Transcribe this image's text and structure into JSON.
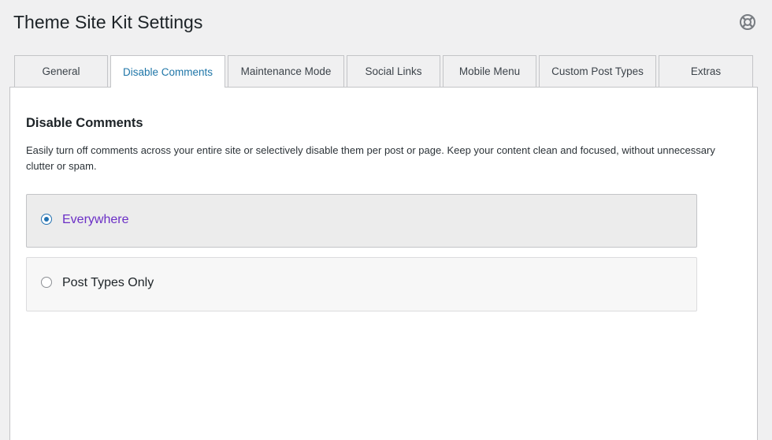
{
  "header": {
    "title": "Theme Site Kit Settings",
    "help_icon": "lifebuoy-icon"
  },
  "tabs": [
    {
      "label": "General",
      "active": false
    },
    {
      "label": "Disable Comments",
      "active": true
    },
    {
      "label": "Maintenance Mode",
      "active": false
    },
    {
      "label": "Social Links",
      "active": false
    },
    {
      "label": "Mobile Menu",
      "active": false
    },
    {
      "label": "Custom Post Types",
      "active": false
    },
    {
      "label": "Extras",
      "active": false
    }
  ],
  "section": {
    "title": "Disable Comments",
    "description": "Easily turn off comments across your entire site or selectively disable them per post or page. Keep your content clean and focused, without unnecessary clutter or spam."
  },
  "options": [
    {
      "label": "Everywhere",
      "selected": true
    },
    {
      "label": "Post Types Only",
      "selected": false
    }
  ],
  "colors": {
    "active_tab_text": "#1f76a8",
    "radio_accent": "#2271b1",
    "selected_option_text": "#6b2fc6",
    "page_background": "#f0f0f1"
  }
}
